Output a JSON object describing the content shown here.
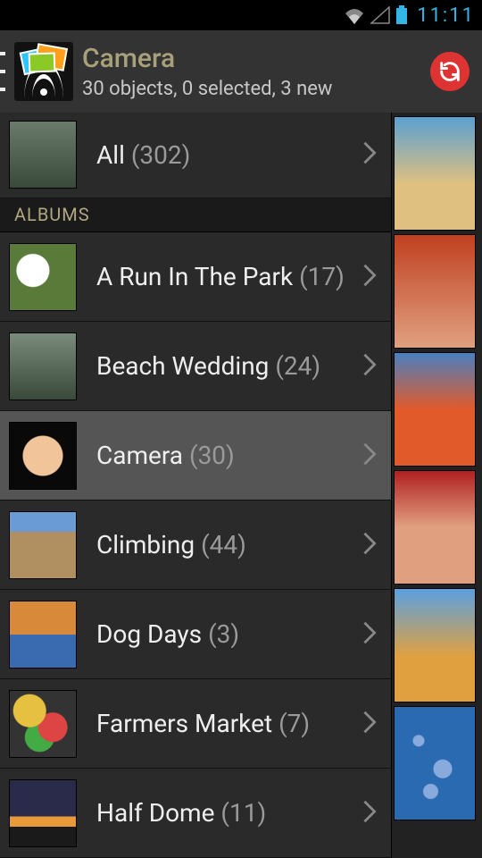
{
  "status": {
    "time": "11:11"
  },
  "header": {
    "title": "Camera",
    "subtitle": "30 objects, 0 selected, 3 new"
  },
  "list": {
    "all_label": "All",
    "all_count": "(302)",
    "section_label": "ALBUMS",
    "albums": [
      {
        "label": "A Run In The Park",
        "count": "(17)",
        "thumb": "t-park",
        "selected": false
      },
      {
        "label": "Beach Wedding",
        "count": "(24)",
        "thumb": "t-beach",
        "selected": false
      },
      {
        "label": "Camera",
        "count": "(30)",
        "thumb": "t-cam",
        "selected": true
      },
      {
        "label": "Climbing",
        "count": "(44)",
        "thumb": "t-climb",
        "selected": false
      },
      {
        "label": "Dog Days",
        "count": "(3)",
        "thumb": "t-dog",
        "selected": false
      },
      {
        "label": "Farmers Market",
        "count": "(7)",
        "thumb": "t-farm",
        "selected": false
      },
      {
        "label": "Half Dome",
        "count": "(11)",
        "thumb": "t-dome",
        "selected": false
      }
    ]
  },
  "icons": {
    "refresh": "refresh-icon",
    "chevron": "chevron-right-icon",
    "wifi": "wifi-icon",
    "signal": "signal-icon",
    "battery": "battery-icon"
  }
}
